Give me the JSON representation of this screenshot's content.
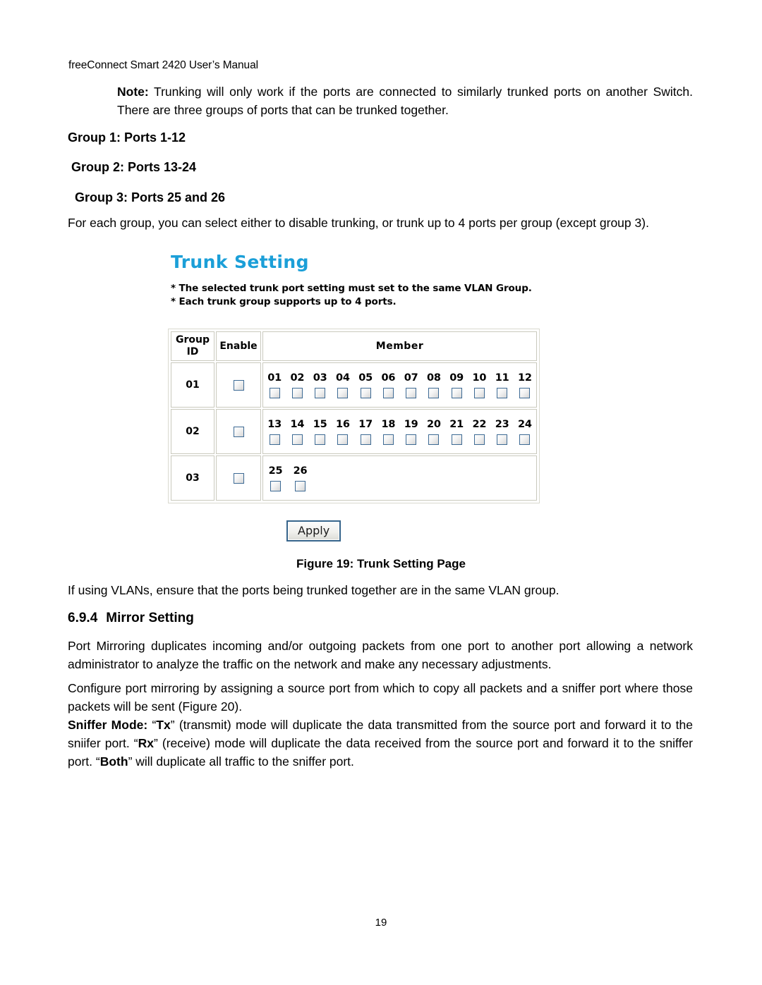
{
  "document": {
    "running_header": "freeConnect Smart 2420 User’s Manual",
    "page_number": "19"
  },
  "note": {
    "label": "Note:",
    "text": " Trunking will only work if the ports are connected to similarly trunked ports on another Switch.  There are three groups of ports that can be trunked together."
  },
  "groups": [
    {
      "heading": "Group 1: Ports 1-12"
    },
    {
      "heading": "Group 2: Ports 13-24"
    },
    {
      "heading": "Group 3: Ports 25 and 26"
    }
  ],
  "paragraphs": {
    "for_each_group": "For each group, you can select either to disable trunking, or trunk up to 4 ports per group (except group 3).",
    "vlan_note": "If using VLANs, ensure that the ports being trunked together are in the same VLAN group.",
    "mirror_intro": "Port Mirroring duplicates incoming and/or outgoing packets from one port to another port allowing a network administrator to analyze the traffic on the network and make any necessary adjustments.",
    "configure": "Configure port mirroring by assigning a source port from which to copy all packets and a sniffer port where those packets will be sent (Figure 20)."
  },
  "sniffer": {
    "label": "Sniffer Mode:",
    "part1": " “",
    "tx": "Tx",
    "part2": "” (transmit) mode will duplicate the data transmitted from the source port and forward it to the sniifer port.  “",
    "rx": "Rx",
    "part3": "” (receive) mode will duplicate the data received from the source port and forward it to the sniffer port.  “",
    "both": "Both",
    "part4": "” will duplicate all traffic to the sniffer port."
  },
  "section": {
    "number": "6.9.4",
    "title": "Mirror Setting"
  },
  "figure": {
    "caption": "Figure 19: Trunk Setting Page",
    "ui": {
      "title": "Trunk Setting",
      "title_color": "#1b9fd8",
      "notes": [
        "* The selected trunk port setting must set to the same VLAN Group.",
        "* Each trunk group supports up to 4 ports."
      ],
      "table": {
        "headers": [
          "Group ID",
          "Enable",
          "Member"
        ],
        "header_group_line1": "Group",
        "header_group_line2": "ID",
        "rows": [
          {
            "group_id": "01",
            "enabled": false,
            "members": [
              "01",
              "02",
              "03",
              "04",
              "05",
              "06",
              "07",
              "08",
              "09",
              "10",
              "11",
              "12"
            ]
          },
          {
            "group_id": "02",
            "enabled": false,
            "members": [
              "13",
              "14",
              "15",
              "16",
              "17",
              "18",
              "19",
              "20",
              "21",
              "22",
              "23",
              "24"
            ]
          },
          {
            "group_id": "03",
            "enabled": false,
            "members": [
              "25",
              "26"
            ]
          }
        ]
      },
      "apply_label": "Apply",
      "checkbox_border_color": "#3d6a94",
      "button_border_color": "#36648b"
    }
  }
}
